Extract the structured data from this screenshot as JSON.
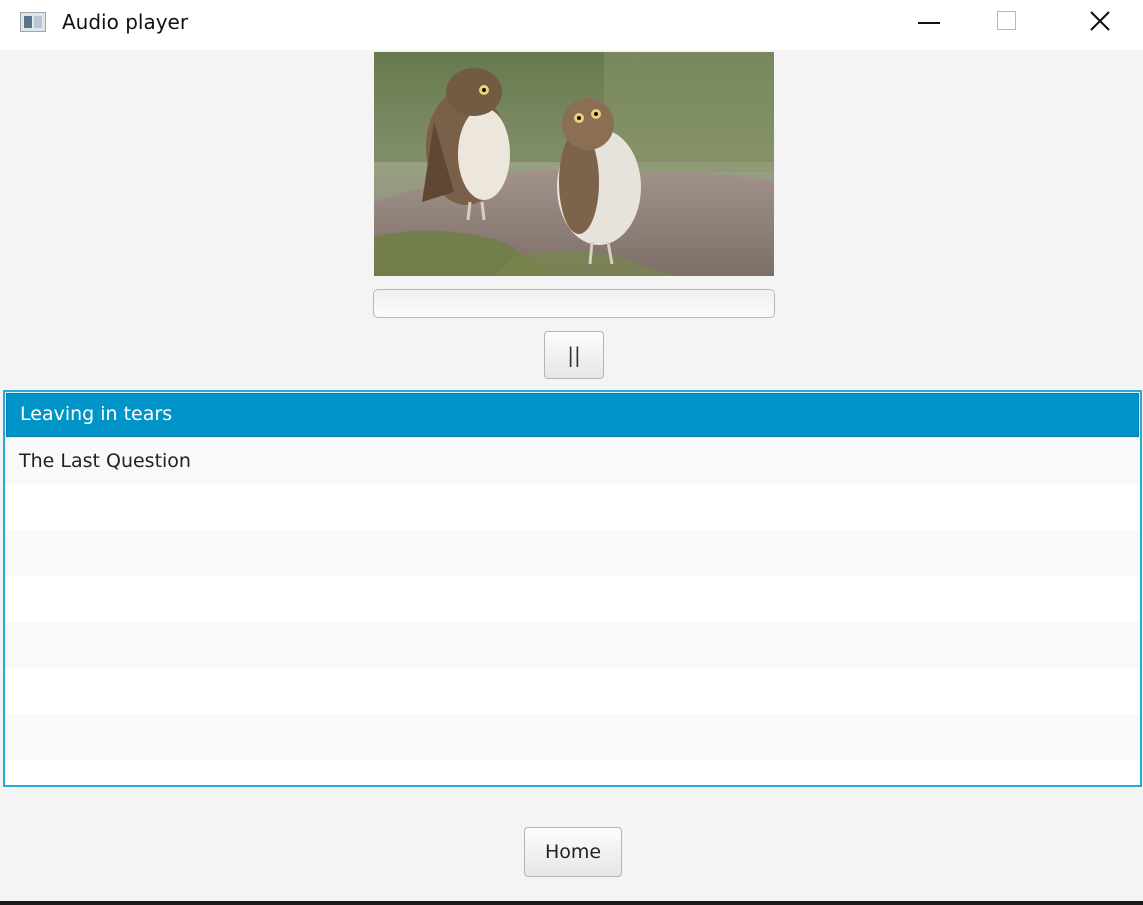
{
  "window": {
    "title": "Audio player"
  },
  "player": {
    "pause_label": "||",
    "progress": 0.0
  },
  "playlist": {
    "items": [
      "Leaving in tears",
      "The Last Question"
    ],
    "selected_index": 0
  },
  "footer": {
    "home_label": "Home"
  },
  "colors": {
    "selection": "#0094c9",
    "focus_border": "#2aa7d9"
  },
  "icons": {
    "app": "app-window-icon",
    "minimize": "minimize-icon",
    "maximize": "maximize-icon",
    "close": "close-icon"
  }
}
